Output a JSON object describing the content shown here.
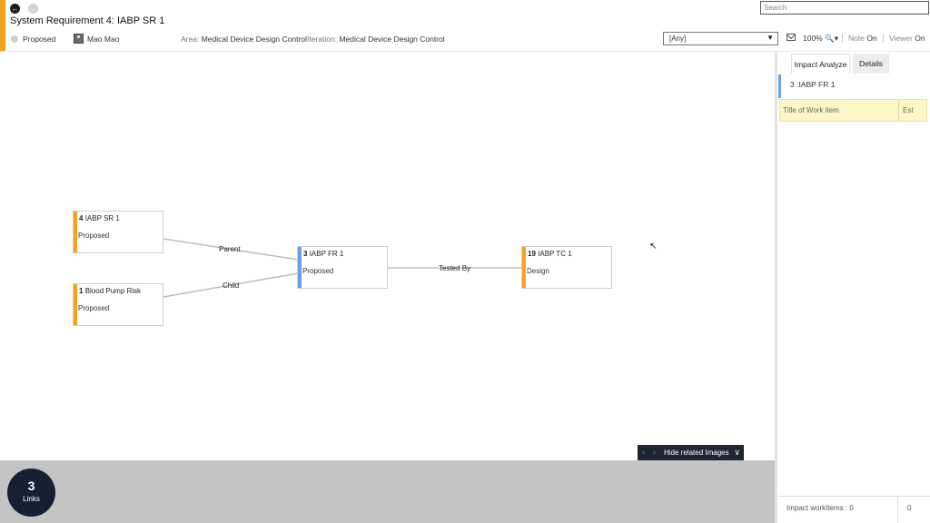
{
  "header": {
    "title": "System Requirement 4: IABP SR 1",
    "state": "Proposed",
    "assignee": "Mao Mao",
    "area_label": "Area:",
    "area_value": "Medical Device Design Control",
    "iteration_label": "Iteration:",
    "iteration_value": "Medical Device Design Control"
  },
  "search": {
    "placeholder": "Search"
  },
  "filter": {
    "selected": "[Any]"
  },
  "toolbar": {
    "zoom": "100%",
    "note_label": "Note",
    "note_value": "On",
    "viewer_label": "Viewer",
    "viewer_value": "On"
  },
  "graph": {
    "nodes": [
      {
        "id": "4",
        "title": "IABP SR 1",
        "state": "Proposed",
        "color": "#f5a31a"
      },
      {
        "id": "1",
        "title": "Blood Pump Risk",
        "state": "Proposed",
        "color": "#f5a31a"
      },
      {
        "id": "3",
        "title": "IABP FR 1",
        "state": "Proposed",
        "color": "#6c9de8"
      },
      {
        "id": "19",
        "title": "IABP TC 1",
        "state": "Design",
        "color": "#f5a31a"
      }
    ],
    "edges": [
      {
        "label": "Parent"
      },
      {
        "label": "Child"
      },
      {
        "label": "Tested By"
      }
    ]
  },
  "related_images": {
    "label": "Hide related Images"
  },
  "links": {
    "count": "3",
    "label": "Links"
  },
  "side_panel": {
    "tabs": [
      {
        "label": "Impact Analyze",
        "active": true
      },
      {
        "label": "Details",
        "active": false
      }
    ],
    "selected_item": "3 :IABP FR 1",
    "columns": [
      "Title of Work item",
      "Est"
    ],
    "footer_label": "Impact workItems : 0",
    "footer_value": "0"
  },
  "colors": {
    "accent": "#f5a31a",
    "functional": "#6c9de8",
    "dark": "#172033"
  }
}
